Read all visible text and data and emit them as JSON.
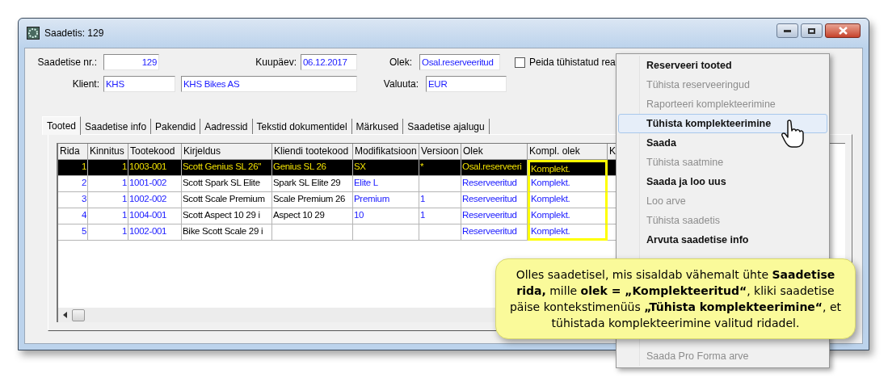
{
  "window": {
    "title": "Saadetis: 129"
  },
  "form": {
    "number_label": "Saadetise nr.:",
    "number": "129",
    "date_label": "Kuupäev:",
    "date": "06.12.2017",
    "status_label": "Olek:",
    "status": "Osal.reserveeritud",
    "hide_cancelled": {
      "label": "Peida tühistatud rea",
      "checked": false
    },
    "client_label": "Klient:",
    "client_code": "KHS",
    "client_name": "KHS Bikes AS",
    "currency_label": "Valuuta:",
    "currency": "EUR"
  },
  "tabs": [
    {
      "label": "Tooted",
      "selected": true
    },
    {
      "label": "Saadetise info",
      "selected": false
    },
    {
      "label": "Pakendid",
      "selected": false
    },
    {
      "label": "Aadressid",
      "selected": false
    },
    {
      "label": "Tekstid dokumentidel",
      "selected": false
    },
    {
      "label": "Märkused",
      "selected": false
    },
    {
      "label": "Saadetise ajalugu",
      "selected": false
    }
  ],
  "table": {
    "columns": [
      {
        "label": "Rida",
        "kind": "number"
      },
      {
        "label": "Kinnitus",
        "kind": "number"
      },
      {
        "label": "Tootekood",
        "kind": "link"
      },
      {
        "label": "Kirjeldus",
        "kind": "text"
      },
      {
        "label": "Kliendi tootekood",
        "kind": "text"
      },
      {
        "label": "Modifikatsioon",
        "kind": "link"
      },
      {
        "label": "Versioon",
        "kind": "link"
      },
      {
        "label": "Olek",
        "kind": "link"
      },
      {
        "label": "Kompl. olek",
        "kind": "link",
        "highlighted": true
      },
      {
        "label": "K",
        "kind": "link"
      }
    ],
    "rows": [
      {
        "selected": true,
        "cells": [
          "1",
          "1",
          "1003-001",
          "Scott Genius SL 26''",
          "Genius SL 26",
          "SX",
          "*",
          "Osal.reserveeri",
          "Komplekt."
        ]
      },
      {
        "selected": false,
        "cells": [
          "2",
          "1",
          "1001-002",
          "Scott Spark SL Elite",
          "Spark SL Elite 29",
          "Elite L",
          "",
          "Reserveeritud",
          "Komplekt."
        ]
      },
      {
        "selected": false,
        "cells": [
          "3",
          "1",
          "1002-002",
          "Scott Scale Premium",
          "Scale Premium 26",
          "Premium",
          "1",
          "Reserveeritud",
          "Komplekt."
        ]
      },
      {
        "selected": false,
        "cells": [
          "4",
          "1",
          "1004-001",
          "Scott Aspect 10 29 i",
          "Aspect 10 29",
          "10",
          "1",
          "Reserveeritud",
          "Komplekt."
        ]
      },
      {
        "selected": false,
        "cells": [
          "5",
          "1",
          "1002-001",
          "Bike Scott Scale 29 i",
          "",
          "",
          "",
          "Reserveeritud",
          "Komplekt."
        ]
      }
    ]
  },
  "context_menu": {
    "items": [
      {
        "label": "Reserveeri tooted",
        "disabled": false,
        "selected": false
      },
      {
        "label": "Tühista reserveeringud",
        "disabled": true,
        "selected": false
      },
      {
        "label": "Raporteeri komplekteerimine",
        "disabled": true,
        "selected": false
      },
      {
        "label": "Tühista komplekteerimine",
        "disabled": false,
        "selected": true
      },
      {
        "label": "Saada",
        "disabled": false,
        "selected": false
      },
      {
        "label": "Tühista saatmine",
        "disabled": true,
        "selected": false
      },
      {
        "label": "Saada ja loo uus",
        "disabled": false,
        "selected": false
      },
      {
        "label": "Loo arve",
        "disabled": true,
        "selected": false
      },
      {
        "label": "Tühista saadetis",
        "disabled": true,
        "selected": false
      },
      {
        "label": "Arvuta saadetise info",
        "disabled": false,
        "selected": false
      },
      {
        "label": "Saada Pro Forma arve",
        "disabled": true,
        "selected": false
      }
    ]
  },
  "callout": {
    "text": "Olles saadetisel, mis sisaldab vähemalt ühte **Saadetise rida,** mille **olek = „Komplekteeritud“**, kliki saadetise päise kontekstimenüüs **„Tühista komplekteerimine“**, et tühistada komplekteerimine valitud ridadel."
  }
}
